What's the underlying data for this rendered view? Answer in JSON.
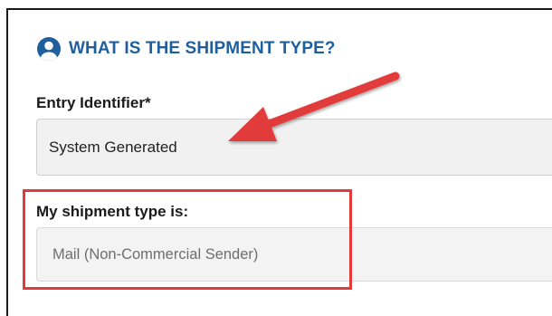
{
  "section": {
    "title": "WHAT IS THE SHIPMENT TYPE?",
    "icon": "user-circle-icon"
  },
  "fields": {
    "entry_identifier": {
      "label": "Entry Identifier*",
      "value": "System Generated"
    },
    "shipment_type": {
      "label": "My shipment type is:",
      "value": "Mail (Non-Commercial Sender)"
    }
  },
  "colors": {
    "heading": "#1f5f9e",
    "annotation": "#e23a3a",
    "field_background": "#f1f1f1"
  }
}
